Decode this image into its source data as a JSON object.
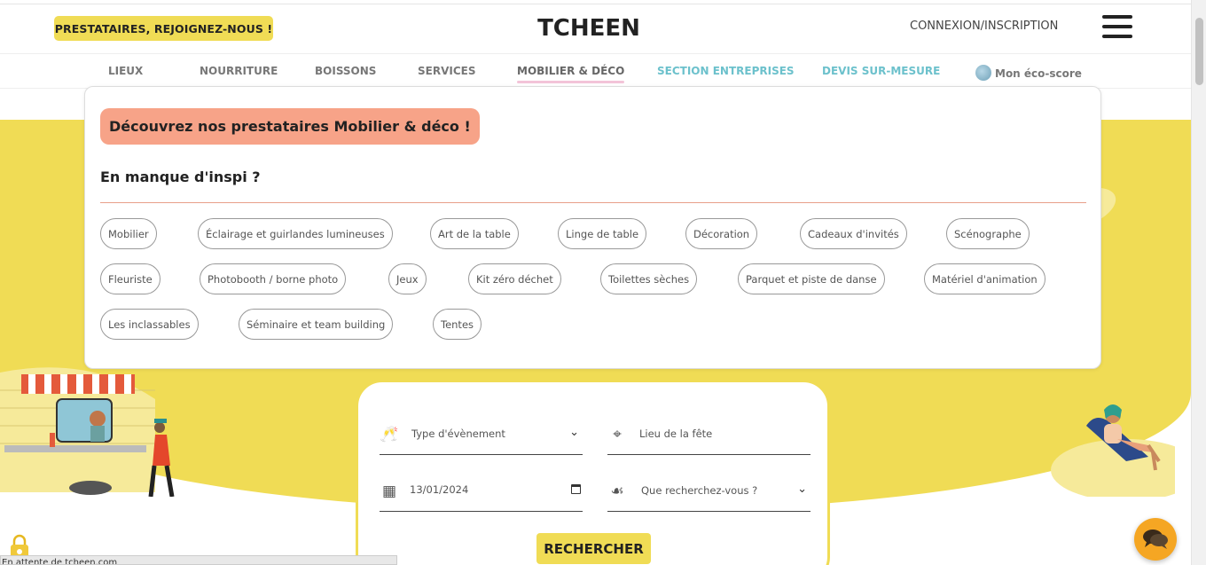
{
  "header": {
    "join_label": "PRESTATAIRES, REJOIGNEZ-NOUS !",
    "logo": "TCHEEN",
    "login_label": "CONNEXION/INSCRIPTION"
  },
  "nav": {
    "items": [
      {
        "label": "LIEUX"
      },
      {
        "label": "NOURRITURE"
      },
      {
        "label": "BOISSONS"
      },
      {
        "label": "SERVICES"
      },
      {
        "label": "MOBILIER & DÉCO"
      },
      {
        "label": "SECTION ENTREPRISES"
      },
      {
        "label": "DEVIS SUR-MESURE"
      },
      {
        "label": "Mon éco-score"
      }
    ]
  },
  "dropdown": {
    "title": "Découvrez nos prestataires Mobilier & déco !",
    "subtitle": "En manque d'inspi ?",
    "tags": [
      "Mobilier",
      "Éclairage et guirlandes lumineuses",
      "Art de la table",
      "Linge de table",
      "Décoration",
      "Cadeaux d'invités",
      "Scénographe",
      "Fleuriste",
      "Photobooth / borne photo",
      "Jeux",
      "Kit zéro déchet",
      "Toilettes sèches",
      "Parquet et piste de danse",
      "Matériel d'animation",
      "Les inclassables",
      "Séminaire et team building",
      "Tentes"
    ]
  },
  "search": {
    "event_type_label": "Type d'évènement",
    "place_placeholder": "Lieu de la fête",
    "date_value": "13/01/2024",
    "what_label": "Que recherchez-vous ?",
    "submit_label": "RECHERCHER"
  },
  "status_text": "En attente de tcheen.com",
  "colors": {
    "accent_yellow": "#f0dc55",
    "title_salmon": "#f7a388",
    "nav_teal": "#6cc1cc",
    "chat_orange": "#f5a623"
  }
}
